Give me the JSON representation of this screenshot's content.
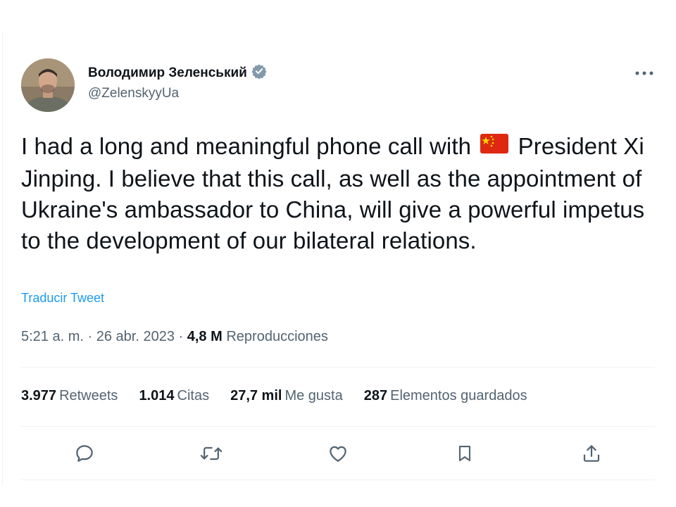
{
  "author": {
    "display_name": "Володимир Зеленський",
    "handle": "@ZelenskyyUa",
    "verified": true,
    "avatar_icon": "profile-photo"
  },
  "tweet": {
    "text_part1": "I had a long and meaningful phone call with",
    "flag_icon": "china-flag-icon",
    "text_part2": "President Xi Jinping. I believe that this call, as well as the appointment of Ukraine's ambassador to China, will give a powerful impetus to the development of our bilateral relations."
  },
  "translate_label": "Traducir Tweet",
  "meta": {
    "time": "5:21 a. m.",
    "separator": "·",
    "date": "26 abr. 2023",
    "views_count": "4,8 M",
    "views_label": "Reproducciones"
  },
  "stats": [
    {
      "count": "3.977",
      "label": "Retweets"
    },
    {
      "count": "1.014",
      "label": "Citas"
    },
    {
      "count": "27,7 mil",
      "label": "Me gusta"
    },
    {
      "count": "287",
      "label": "Elementos guardados"
    }
  ],
  "actions": [
    "reply-icon",
    "retweet-icon",
    "like-icon",
    "bookmark-icon",
    "share-icon"
  ],
  "colors": {
    "text_primary": "#0f1419",
    "text_secondary": "#536471",
    "accent": "#1d9bf0",
    "verified_badge": "#829aab"
  }
}
